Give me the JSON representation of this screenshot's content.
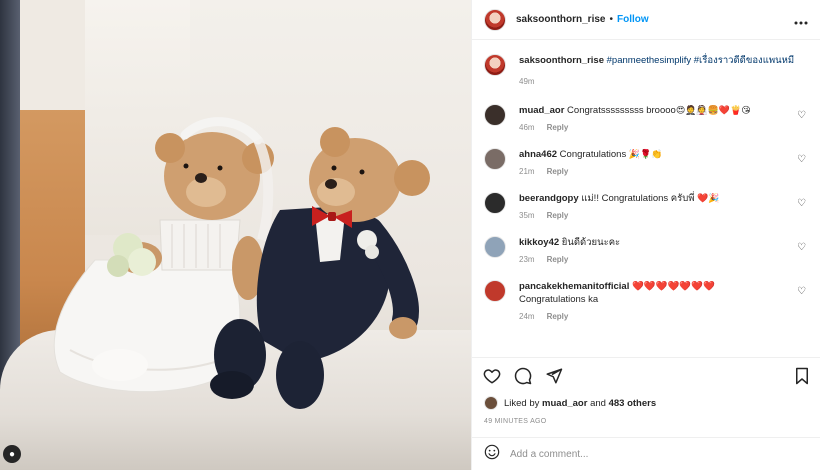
{
  "post": {
    "author": "saksoonthorn_rise",
    "follow_label": "Follow",
    "more_icon": "more-horizontal-icon",
    "caption": {
      "author": "saksoonthorn_rise",
      "hashtags": "#panmeethesimplify #เรื่องราวดีดีของแพนหมี",
      "time": "49m"
    }
  },
  "comments": [
    {
      "user": "muad_aor",
      "text": "Congratsssssssss broooo",
      "emoji": "😍🤵👰🍔❤️🍟😘",
      "time": "46m",
      "reply": "Reply",
      "avatar_color": "#3a2f2a"
    },
    {
      "user": "ahna462",
      "text": "Congratulations",
      "emoji": "🎉🌹👏",
      "time": "21m",
      "reply": "Reply",
      "avatar_color": "#7a6c66"
    },
    {
      "user": "beerandgopy",
      "text": "แม่!! Congratulations ครับพี่",
      "emoji": "❤️🎉",
      "time": "35m",
      "reply": "Reply",
      "avatar_color": "#2b2b2b"
    },
    {
      "user": "kikkoy42",
      "text": "ยินดีด้วยนะคะ",
      "emoji": "",
      "time": "23m",
      "reply": "Reply",
      "avatar_color": "#8fa3b8"
    },
    {
      "user": "pancakekhemanitofficial",
      "text": "❤️❤️❤️❤️❤️❤️❤️",
      "emoji": "",
      "line2": "Congratulations ka",
      "time": "24m",
      "reply": "Reply",
      "avatar_color": "#c0392b"
    }
  ],
  "actions": {
    "like_icon": "heart-icon",
    "comment_icon": "comment-icon",
    "share_icon": "share-icon",
    "save_icon": "bookmark-icon"
  },
  "likes": {
    "prefix": "Liked by",
    "user": "muad_aor",
    "middle": "and",
    "others": "483 others"
  },
  "posted_time": "49 MINUTES AGO",
  "add_comment": {
    "placeholder": "Add a comment...",
    "emoji_icon": "smiley-icon"
  },
  "colors": {
    "link_blue": "#0095f6",
    "hashtag": "#00376b",
    "muted": "#8e8e8e"
  }
}
